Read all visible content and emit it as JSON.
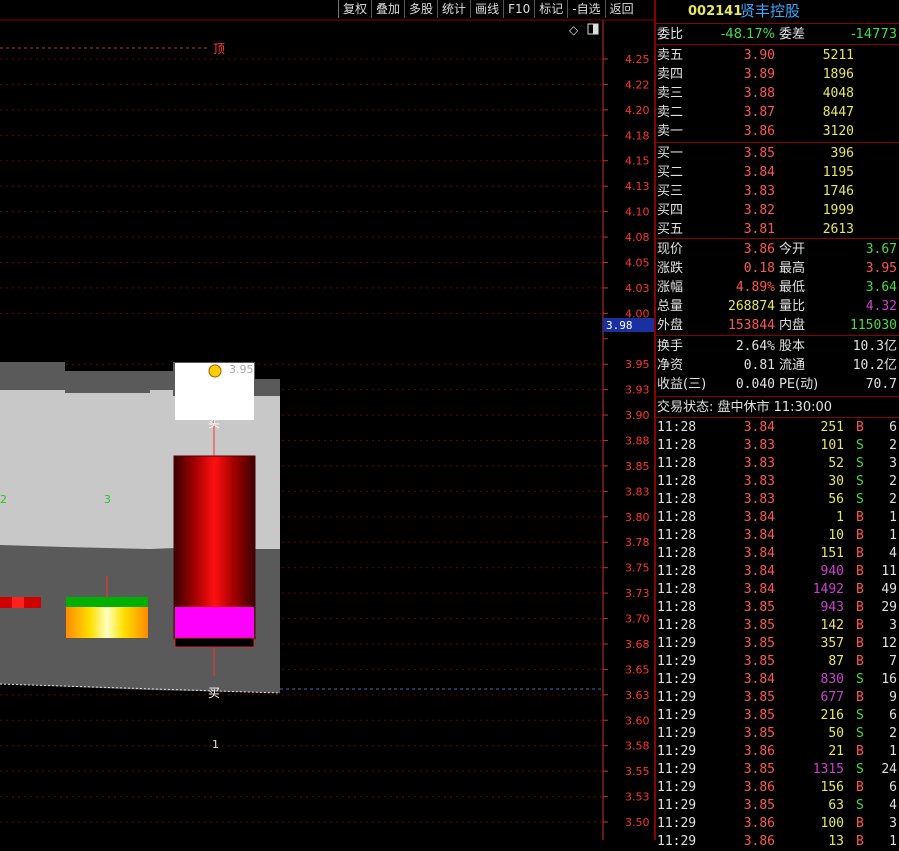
{
  "toolbar": [
    {
      "label": "复权"
    },
    {
      "label": "叠加"
    },
    {
      "label": "多股"
    },
    {
      "label": "统计"
    },
    {
      "label": "画线"
    },
    {
      "label": "F10"
    },
    {
      "label": "标记"
    },
    {
      "label": "-自选"
    },
    {
      "label": "返回"
    }
  ],
  "stock": {
    "code": "002141",
    "name": "贤丰控股"
  },
  "weibi": {
    "label": "委比",
    "value": "-48.17%",
    "diff_label": "委差",
    "diff_value": "-14773"
  },
  "sell": [
    {
      "label": "卖五",
      "price": "3.90",
      "vol": "5211"
    },
    {
      "label": "卖四",
      "price": "3.89",
      "vol": "1896"
    },
    {
      "label": "卖三",
      "price": "3.88",
      "vol": "4048"
    },
    {
      "label": "卖二",
      "price": "3.87",
      "vol": "8447"
    },
    {
      "label": "卖一",
      "price": "3.86",
      "vol": "3120"
    }
  ],
  "buy": [
    {
      "label": "买一",
      "price": "3.85",
      "vol": "396"
    },
    {
      "label": "买二",
      "price": "3.84",
      "vol": "1195"
    },
    {
      "label": "买三",
      "price": "3.83",
      "vol": "1746"
    },
    {
      "label": "买四",
      "price": "3.82",
      "vol": "1999"
    },
    {
      "label": "买五",
      "price": "3.81",
      "vol": "2613"
    }
  ],
  "quote": [
    {
      "l1": "现价",
      "v1": "3.86",
      "l2": "今开",
      "v2": "3.67"
    },
    {
      "l1": "涨跌",
      "v1": "0.18",
      "l2": "最高",
      "v2": "3.95"
    },
    {
      "l1": "涨幅",
      "v1": "4.89%",
      "l2": "最低",
      "v2": "3.64"
    },
    {
      "l1": "总量",
      "v1": "268874",
      "l2": "量比",
      "v2": "4.32"
    },
    {
      "l1": "外盘",
      "v1": "153844",
      "l2": "内盘",
      "v2": "115030"
    }
  ],
  "fund": [
    {
      "l1": "换手",
      "v1": "2.64%",
      "l2": "股本",
      "v2": "10.3亿"
    },
    {
      "l1": "净资",
      "v1": "0.81",
      "l2": "流通",
      "v2": "10.2亿"
    },
    {
      "l1": "收益(三)",
      "v1": "0.040",
      "l2": "PE(动)",
      "v2": "70.7"
    }
  ],
  "trade_status": "交易状态: 盘中休市 11:30:00",
  "ticks": [
    {
      "t": "11:28",
      "p": "3.84",
      "v": "251",
      "s": "B",
      "n": "6"
    },
    {
      "t": "11:28",
      "p": "3.83",
      "v": "101",
      "s": "S",
      "n": "2"
    },
    {
      "t": "11:28",
      "p": "3.83",
      "v": "52",
      "s": "S",
      "n": "3"
    },
    {
      "t": "11:28",
      "p": "3.83",
      "v": "30",
      "s": "S",
      "n": "2"
    },
    {
      "t": "11:28",
      "p": "3.83",
      "v": "56",
      "s": "S",
      "n": "2"
    },
    {
      "t": "11:28",
      "p": "3.84",
      "v": "1",
      "s": "B",
      "n": "1"
    },
    {
      "t": "11:28",
      "p": "3.84",
      "v": "10",
      "s": "B",
      "n": "1"
    },
    {
      "t": "11:28",
      "p": "3.84",
      "v": "151",
      "s": "B",
      "n": "4"
    },
    {
      "t": "11:28",
      "p": "3.84",
      "v": "940",
      "s": "B",
      "n": "11"
    },
    {
      "t": "11:28",
      "p": "3.84",
      "v": "1492",
      "s": "B",
      "n": "49"
    },
    {
      "t": "11:28",
      "p": "3.85",
      "v": "943",
      "s": "B",
      "n": "29"
    },
    {
      "t": "11:28",
      "p": "3.85",
      "v": "142",
      "s": "B",
      "n": "3"
    },
    {
      "t": "11:29",
      "p": "3.85",
      "v": "357",
      "s": "B",
      "n": "12"
    },
    {
      "t": "11:29",
      "p": "3.85",
      "v": "87",
      "s": "B",
      "n": "7"
    },
    {
      "t": "11:29",
      "p": "3.84",
      "v": "830",
      "s": "S",
      "n": "16"
    },
    {
      "t": "11:29",
      "p": "3.85",
      "v": "677",
      "s": "B",
      "n": "9"
    },
    {
      "t": "11:29",
      "p": "3.85",
      "v": "216",
      "s": "S",
      "n": "6"
    },
    {
      "t": "11:29",
      "p": "3.85",
      "v": "50",
      "s": "S",
      "n": "2"
    },
    {
      "t": "11:29",
      "p": "3.86",
      "v": "21",
      "s": "B",
      "n": "1"
    },
    {
      "t": "11:29",
      "p": "3.85",
      "v": "1315",
      "s": "S",
      "n": "24"
    },
    {
      "t": "11:29",
      "p": "3.86",
      "v": "156",
      "s": "B",
      "n": "6"
    },
    {
      "t": "11:29",
      "p": "3.85",
      "v": "63",
      "s": "S",
      "n": "4"
    },
    {
      "t": "11:29",
      "p": "3.86",
      "v": "100",
      "s": "B",
      "n": "3"
    },
    {
      "t": "11:29",
      "p": "3.86",
      "v": "13",
      "s": "B",
      "n": "1"
    }
  ],
  "chart": {
    "axis_ticks": [
      "4.25",
      "4.22",
      "4.20",
      "4.18",
      "4.15",
      "4.13",
      "4.10",
      "4.08",
      "4.05",
      "4.03",
      "4.00",
      "3.98",
      "3.95",
      "3.93",
      "3.90",
      "3.88",
      "3.85",
      "3.83",
      "3.80",
      "3.78",
      "3.75",
      "3.73",
      "3.70",
      "3.68",
      "3.65",
      "3.63",
      "3.60",
      "3.58",
      "3.55",
      "3.53",
      "3.50"
    ],
    "current_price": "3.98",
    "top_label": "顶",
    "high_label": "3.95",
    "buy_label": "买",
    "buy_label_2": "买",
    "num_labels": [
      "2",
      "3",
      "1"
    ],
    "candle": {
      "open": 3.67,
      "close": 3.86,
      "high": 3.95,
      "low": 3.64
    },
    "colors": {
      "grid": "#7a0000",
      "axis": "#c03030",
      "up": "#ff2020",
      "cyan": "#39a8ff"
    }
  }
}
